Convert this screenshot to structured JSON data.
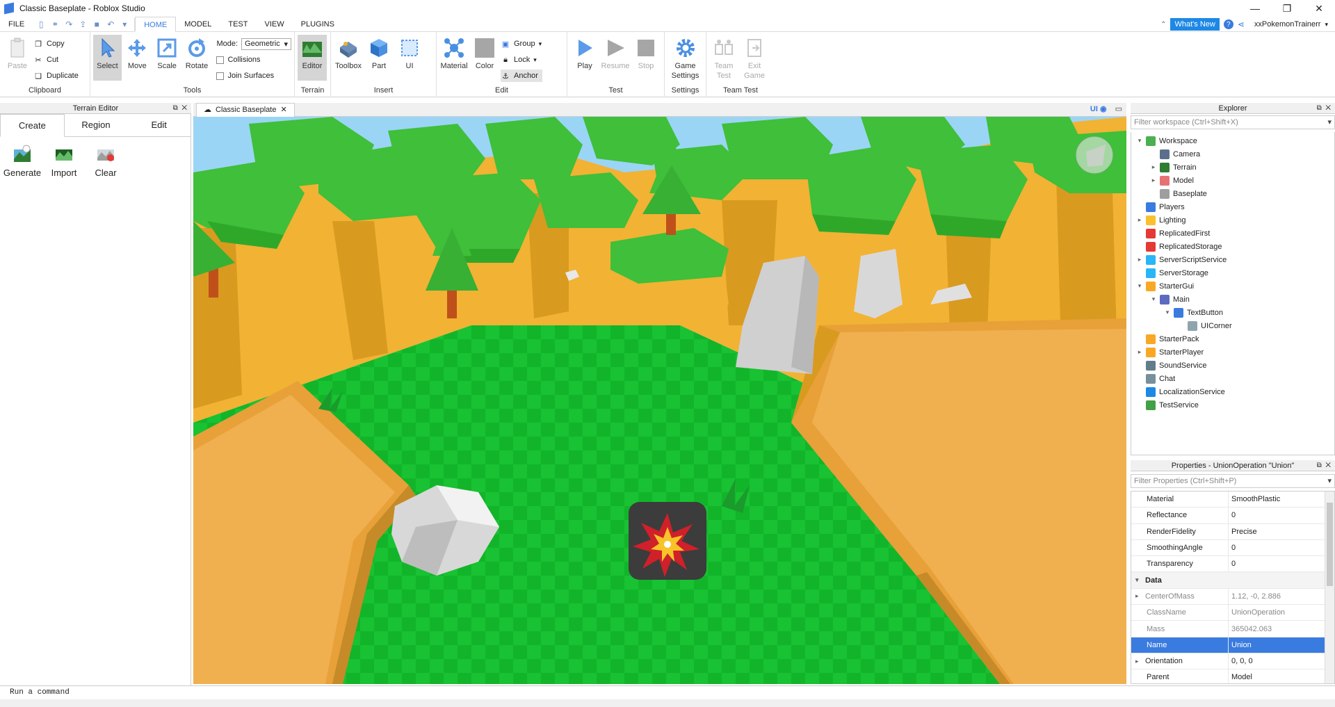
{
  "window": {
    "title": "Classic Baseplate - Roblox Studio",
    "min": "—",
    "max": "❐",
    "close": "✕"
  },
  "menu": {
    "file": "FILE",
    "tabs": [
      {
        "label": "HOME",
        "active": true
      },
      {
        "label": "MODEL",
        "active": false
      },
      {
        "label": "TEST",
        "active": false
      },
      {
        "label": "VIEW",
        "active": false
      },
      {
        "label": "PLUGINS",
        "active": false
      }
    ],
    "whats_new": "What's New",
    "help": "?",
    "username": "xxPokemonTrainerr"
  },
  "ribbon": {
    "clipboard": {
      "label": "Clipboard",
      "paste": "Paste",
      "copy": "Copy",
      "cut": "Cut",
      "duplicate": "Duplicate"
    },
    "tools": {
      "label": "Tools",
      "select": "Select",
      "move": "Move",
      "scale": "Scale",
      "rotate": "Rotate",
      "mode_label": "Mode:",
      "mode_value": "Geometric",
      "collisions": "Collisions",
      "join_surfaces": "Join Surfaces"
    },
    "terrain": {
      "label": "Terrain",
      "editor": "Editor"
    },
    "insert": {
      "label": "Insert",
      "toolbox": "Toolbox",
      "part": "Part",
      "ui": "UI"
    },
    "edit": {
      "label": "Edit",
      "material": "Material",
      "color": "Color",
      "group": "Group",
      "lock": "Lock",
      "anchor": "Anchor"
    },
    "test": {
      "label": "Test",
      "play": "Play",
      "resume": "Resume",
      "stop": "Stop"
    },
    "settings": {
      "label": "Settings",
      "game_settings": "Game Settings"
    },
    "team_test": {
      "label": "Team Test",
      "team_test": "Team Test",
      "exit_game": "Exit Game"
    }
  },
  "terrain_editor": {
    "title": "Terrain Editor",
    "tabs": [
      "Create",
      "Region",
      "Edit"
    ],
    "tools": [
      "Generate",
      "Import",
      "Clear"
    ]
  },
  "viewport": {
    "tab_label": "Classic Baseplate",
    "ui_toggle": "UI"
  },
  "explorer": {
    "title": "Explorer",
    "filter_placeholder": "Filter workspace (Ctrl+Shift+X)",
    "items": [
      {
        "label": "Workspace",
        "depth": 0,
        "arrow": "▾",
        "icon_color": "#4caf50"
      },
      {
        "label": "Camera",
        "depth": 1,
        "arrow": "",
        "icon_color": "#5a6f8c"
      },
      {
        "label": "Terrain",
        "depth": 1,
        "arrow": "▸",
        "icon_color": "#2e7d32"
      },
      {
        "label": "Model",
        "depth": 1,
        "arrow": "▸",
        "icon_color": "#e57373"
      },
      {
        "label": "Baseplate",
        "depth": 1,
        "arrow": "",
        "icon_color": "#9e9e9e"
      },
      {
        "label": "Players",
        "depth": 0,
        "arrow": "",
        "icon_color": "#3a7be0"
      },
      {
        "label": "Lighting",
        "depth": 0,
        "arrow": "▸",
        "icon_color": "#fbc02d"
      },
      {
        "label": "ReplicatedFirst",
        "depth": 0,
        "arrow": "",
        "icon_color": "#e53935"
      },
      {
        "label": "ReplicatedStorage",
        "depth": 0,
        "arrow": "",
        "icon_color": "#e53935"
      },
      {
        "label": "ServerScriptService",
        "depth": 0,
        "arrow": "▸",
        "icon_color": "#29b6f6"
      },
      {
        "label": "ServerStorage",
        "depth": 0,
        "arrow": "",
        "icon_color": "#29b6f6"
      },
      {
        "label": "StarterGui",
        "depth": 0,
        "arrow": "▾",
        "icon_color": "#f9a825"
      },
      {
        "label": "Main",
        "depth": 1,
        "arrow": "▾",
        "icon_color": "#5c6bc0"
      },
      {
        "label": "TextButton",
        "depth": 2,
        "arrow": "▾",
        "icon_color": "#3a7be0"
      },
      {
        "label": "UICorner",
        "depth": 3,
        "arrow": "",
        "icon_color": "#90a4ae"
      },
      {
        "label": "StarterPack",
        "depth": 0,
        "arrow": "",
        "icon_color": "#f9a825"
      },
      {
        "label": "StarterPlayer",
        "depth": 0,
        "arrow": "▸",
        "icon_color": "#f9a825"
      },
      {
        "label": "SoundService",
        "depth": 0,
        "arrow": "",
        "icon_color": "#607d8b"
      },
      {
        "label": "Chat",
        "depth": 0,
        "arrow": "",
        "icon_color": "#78909c"
      },
      {
        "label": "LocalizationService",
        "depth": 0,
        "arrow": "",
        "icon_color": "#1e88e5"
      },
      {
        "label": "TestService",
        "depth": 0,
        "arrow": "",
        "icon_color": "#43a047"
      }
    ]
  },
  "properties": {
    "title": "Properties - UnionOperation \"Union\"",
    "filter_placeholder": "Filter Properties (Ctrl+Shift+P)",
    "rows": [
      {
        "name": "Material",
        "value": "SmoothPlastic",
        "kind": "normal"
      },
      {
        "name": "Reflectance",
        "value": "0",
        "kind": "normal"
      },
      {
        "name": "RenderFidelity",
        "value": "Precise",
        "kind": "normal"
      },
      {
        "name": "SmoothingAngle",
        "value": "0",
        "kind": "normal"
      },
      {
        "name": "Transparency",
        "value": "0",
        "kind": "normal"
      },
      {
        "name": "Data",
        "value": "",
        "kind": "header"
      },
      {
        "name": "CenterOfMass",
        "value": "1.12, -0, 2.886",
        "kind": "readonly",
        "arrow": "▸"
      },
      {
        "name": "ClassName",
        "value": "UnionOperation",
        "kind": "readonly"
      },
      {
        "name": "Mass",
        "value": "365042.063",
        "kind": "readonly"
      },
      {
        "name": "Name",
        "value": "Union",
        "kind": "selected"
      },
      {
        "name": "Orientation",
        "value": "0, 0, 0",
        "kind": "normal",
        "arrow": "▸"
      },
      {
        "name": "Parent",
        "value": "Model",
        "kind": "normal"
      }
    ]
  },
  "command_bar": {
    "placeholder": "Run a command"
  },
  "colors": {
    "accent": "#3a7be0",
    "grass": "#14b82a",
    "sand": "#e8a038",
    "foliage": "#3fbf3a",
    "cliff": "#f0b030"
  }
}
